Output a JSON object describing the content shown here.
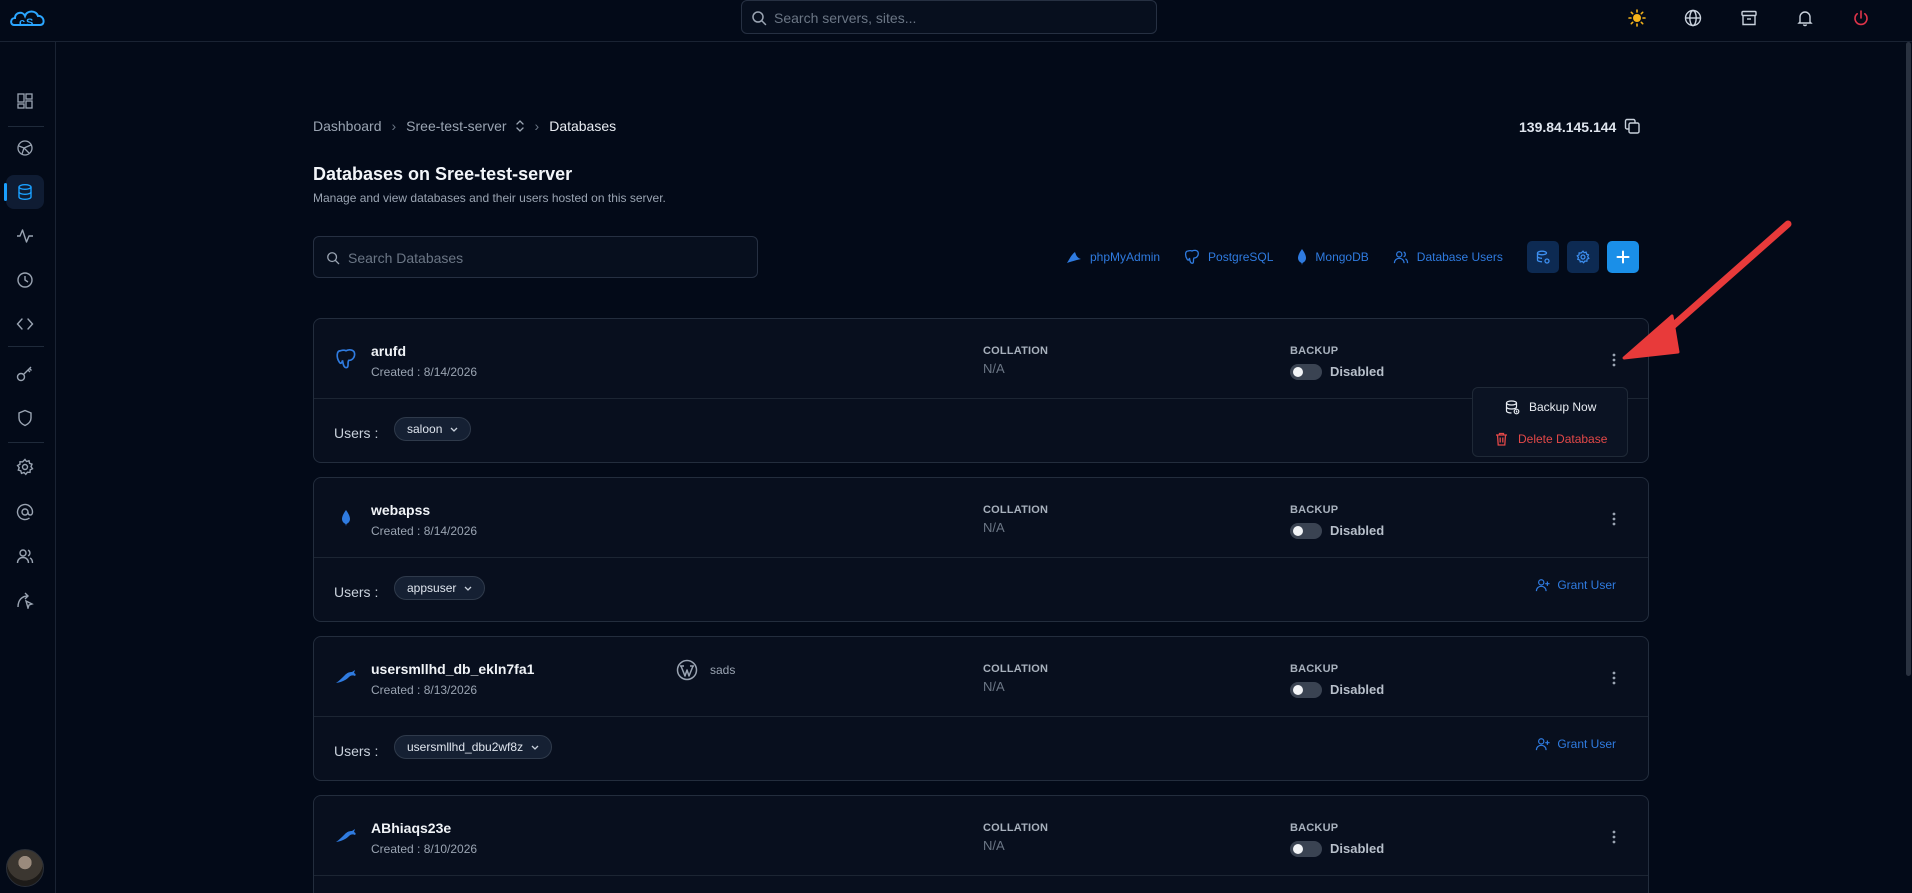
{
  "header": {
    "search_placeholder": "Search servers, sites...",
    "icons": [
      "logo-icon",
      "sun-icon",
      "globe-icon",
      "archive-icon",
      "bell-icon",
      "power-icon"
    ]
  },
  "sidebar": {
    "items": [
      "dashboard-icon",
      "network-icon",
      "database-icon",
      "activity-icon",
      "clock-icon",
      "code-icon",
      "key-icon",
      "shield-icon",
      "settings-icon",
      "at-icon",
      "users-icon",
      "deploy-icon"
    ],
    "active": "database-icon"
  },
  "breadcrumb": {
    "items": [
      "Dashboard",
      "Sree-test-server",
      "Databases"
    ]
  },
  "server_ip": "139.84.145.144",
  "page": {
    "title": "Databases on Sree-test-server",
    "subtitle": "Manage and view databases and their users hosted on this server.",
    "search_placeholder": "Search Databases"
  },
  "toolbar": {
    "phpmyadmin": "phpMyAdmin",
    "postgresql": "PostgreSQL",
    "mongodb": "MongoDB",
    "db_users": "Database Users"
  },
  "labels": {
    "collation": "COLLATION",
    "backup": "BACKUP",
    "users": "Users :",
    "grant_user": "Grant User"
  },
  "databases": [
    {
      "name": "arufd",
      "created": "Created : 8/14/2026",
      "engine": "postgresql",
      "site": "",
      "collation": "N/A",
      "backup": "Disabled",
      "user": "saloon"
    },
    {
      "name": "webapss",
      "created": "Created : 8/14/2026",
      "engine": "mongodb",
      "site": "",
      "collation": "N/A",
      "backup": "Disabled",
      "user": "appsuser"
    },
    {
      "name": "usersmllhd_db_ekln7fa1",
      "created": "Created : 8/13/2026",
      "engine": "mysql",
      "site": "sads",
      "collation": "N/A",
      "backup": "Disabled",
      "user": "usersmllhd_dbu2wf8z"
    },
    {
      "name": "ABhiaqs23e",
      "created": "Created : 8/10/2026",
      "engine": "mysql",
      "site": "",
      "collation": "N/A",
      "backup": "Disabled",
      "user": ""
    }
  ],
  "dropdown": {
    "backup_now": "Backup Now",
    "delete_database": "Delete Database"
  },
  "colors": {
    "background": "#030a18",
    "accent": "#1a8fe8",
    "link": "#2f7be0",
    "danger": "#e34848",
    "annotation_arrow": "#e83a3a"
  }
}
